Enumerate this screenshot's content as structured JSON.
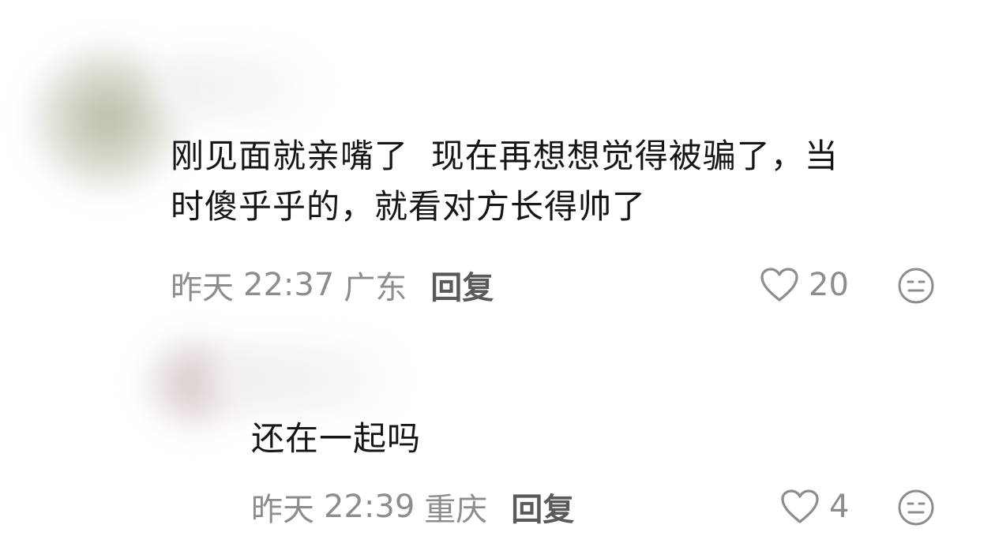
{
  "comments": [
    {
      "text_line1": "刚见面就亲嘴了  现在再想想觉得被骗了，当",
      "text_line2": "时傻乎乎的，就看对方长得帅了",
      "time": "昨天",
      "clock": "22:37",
      "location": "广东",
      "reply_label": "回复",
      "likes": "20",
      "like_icon": "heart-outline-icon",
      "dislike_icon": "meh-face-icon"
    },
    {
      "text_line1": "还在一起吗",
      "time": "昨天",
      "clock": "22:39",
      "location": "重庆",
      "reply_label": "回复",
      "likes": "4",
      "like_icon": "heart-outline-icon",
      "dislike_icon": "meh-face-icon"
    }
  ],
  "colors": {
    "text": "#161616",
    "meta": "#8d8d8d",
    "reply": "#5a5a5a"
  }
}
